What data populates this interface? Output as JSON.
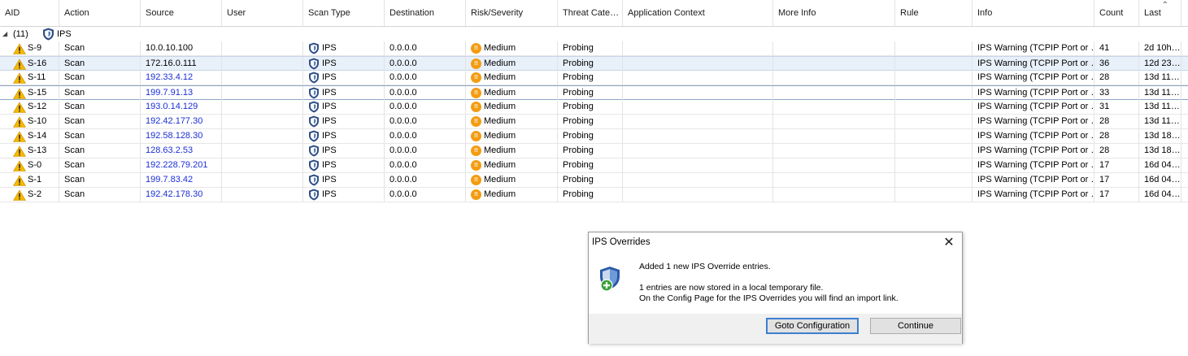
{
  "table": {
    "columns": [
      "AID",
      "Action",
      "Source",
      "User",
      "Scan Type",
      "Destination",
      "Risk/Severity",
      "Threat Cate…",
      "Application Context",
      "More Info",
      "Rule",
      "Info",
      "Count",
      "Last"
    ],
    "group": {
      "count_label": "(11)",
      "label": "IPS"
    },
    "rows": [
      {
        "aid": "S-9",
        "action": "Scan",
        "source": "10.0.10.100",
        "scan_type": "IPS",
        "destination": "0.0.0.0",
        "severity": "Medium",
        "threat": "Probing",
        "info": "IPS Warning (TCPIP Port or …",
        "count": "41",
        "last": "2d 10h…"
      },
      {
        "aid": "S-16",
        "action": "Scan",
        "source": "172.16.0.111",
        "scan_type": "IPS",
        "destination": "0.0.0.0",
        "severity": "Medium",
        "threat": "Probing",
        "info": "IPS Warning (TCPIP Port or …",
        "count": "36",
        "last": "12d 23…"
      },
      {
        "aid": "S-11",
        "action": "Scan",
        "source": "192.33.4.12",
        "scan_type": "IPS",
        "destination": "0.0.0.0",
        "severity": "Medium",
        "threat": "Probing",
        "info": "IPS Warning (TCPIP Port or …",
        "count": "28",
        "last": "13d 11…"
      },
      {
        "aid": "S-15",
        "action": "Scan",
        "source": "199.7.91.13",
        "scan_type": "IPS",
        "destination": "0.0.0.0",
        "severity": "Medium",
        "threat": "Probing",
        "info": "IPS Warning (TCPIP Port or …",
        "count": "33",
        "last": "13d 11…"
      },
      {
        "aid": "S-12",
        "action": "Scan",
        "source": "193.0.14.129",
        "scan_type": "IPS",
        "destination": "0.0.0.0",
        "severity": "Medium",
        "threat": "Probing",
        "info": "IPS Warning (TCPIP Port or …",
        "count": "31",
        "last": "13d 11…"
      },
      {
        "aid": "S-10",
        "action": "Scan",
        "source": "192.42.177.30",
        "scan_type": "IPS",
        "destination": "0.0.0.0",
        "severity": "Medium",
        "threat": "Probing",
        "info": "IPS Warning (TCPIP Port or …",
        "count": "28",
        "last": "13d 11…"
      },
      {
        "aid": "S-14",
        "action": "Scan",
        "source": "192.58.128.30",
        "scan_type": "IPS",
        "destination": "0.0.0.0",
        "severity": "Medium",
        "threat": "Probing",
        "info": "IPS Warning (TCPIP Port or …",
        "count": "28",
        "last": "13d 18…"
      },
      {
        "aid": "S-13",
        "action": "Scan",
        "source": "128.63.2.53",
        "scan_type": "IPS",
        "destination": "0.0.0.0",
        "severity": "Medium",
        "threat": "Probing",
        "info": "IPS Warning (TCPIP Port or …",
        "count": "28",
        "last": "13d 18…"
      },
      {
        "aid": "S-0",
        "action": "Scan",
        "source": "192.228.79.201",
        "scan_type": "IPS",
        "destination": "0.0.0.0",
        "severity": "Medium",
        "threat": "Probing",
        "info": "IPS Warning (TCPIP Port or …",
        "count": "17",
        "last": "16d 04…"
      },
      {
        "aid": "S-1",
        "action": "Scan",
        "source": "199.7.83.42",
        "scan_type": "IPS",
        "destination": "0.0.0.0",
        "severity": "Medium",
        "threat": "Probing",
        "info": "IPS Warning (TCPIP Port or …",
        "count": "17",
        "last": "16d 04…"
      },
      {
        "aid": "S-2",
        "action": "Scan",
        "source": "192.42.178.30",
        "scan_type": "IPS",
        "destination": "0.0.0.0",
        "severity": "Medium",
        "threat": "Probing",
        "info": "IPS Warning (TCPIP Port or …",
        "count": "17",
        "last": "16d 04…"
      }
    ]
  },
  "dialog": {
    "title": "IPS Overrides",
    "close_glyph": "✕",
    "line1": "Added 1 new IPS Override entries.",
    "line2": "1 entries are now stored in a local temporary file.",
    "line3": "On the Config Page for the IPS Overrides you will find an import link.",
    "goto_button": "Goto Configuration",
    "continue_button": "Continue"
  },
  "colors": {
    "link": "#1a2fd6",
    "severity_medium": "#f39c12",
    "warning": "#f5b800",
    "shield": "#2e4e86"
  },
  "icons": {
    "row": "warning-icon",
    "scan_type": "shield-icon",
    "severity": "medium-severity-icon",
    "dialog": "ips-override-add-icon"
  }
}
